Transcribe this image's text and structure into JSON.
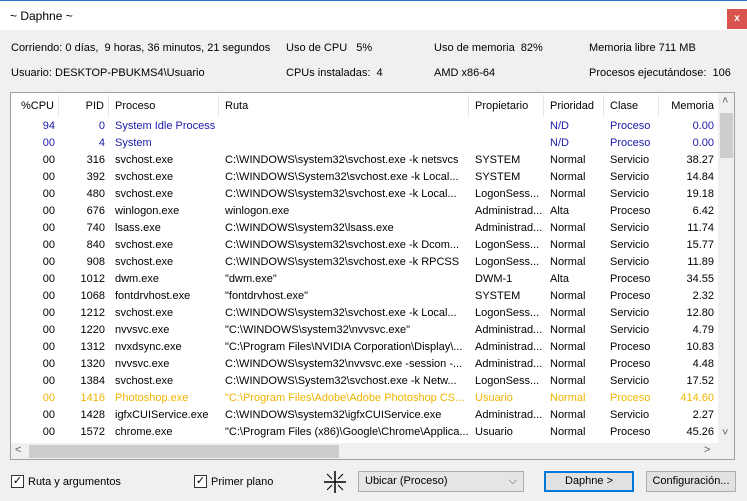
{
  "window": {
    "title": "~ Daphne ~",
    "close_label": "x"
  },
  "info": {
    "uptime": "Corriendo: 0 días,  9 horas, 36 minutos, 21 segundos",
    "cpu_usage": "Uso de CPU   5%",
    "memory_usage": "Uso de memoria  82%",
    "free_memory": "Memoria libre 711 MB",
    "user": "Usuario: DESKTOP-PBUKMS4\\Usuario",
    "cpus": "CPUs instaladas:  4",
    "arch": "AMD x86-64",
    "processes": "Procesos ejecutándose:  106"
  },
  "colors": {
    "system": "#1a1aa6",
    "highlight": "#f0b400",
    "normal": "#000000"
  },
  "table": {
    "columns": [
      "%CPU",
      "PID",
      "Proceso",
      "Ruta",
      "Propietario",
      "Prioridad",
      "Clase",
      "Memoria"
    ],
    "rows": [
      {
        "cpu": "94",
        "pid": "0",
        "name": "System Idle Process",
        "path": "",
        "owner": "",
        "priority": "N/D",
        "class": "Proceso",
        "mem": "0.00",
        "style": "system"
      },
      {
        "cpu": "00",
        "pid": "4",
        "name": "System",
        "path": "",
        "owner": "",
        "priority": "N/D",
        "class": "Proceso",
        "mem": "0.00",
        "style": "system"
      },
      {
        "cpu": "00",
        "pid": "316",
        "name": "svchost.exe",
        "path": "C:\\WINDOWS\\system32\\svchost.exe -k netsvcs",
        "owner": "SYSTEM",
        "priority": "Normal",
        "class": "Servicio",
        "mem": "38.27",
        "style": "normal"
      },
      {
        "cpu": "00",
        "pid": "392",
        "name": "svchost.exe",
        "path": "C:\\WINDOWS\\System32\\svchost.exe -k Local...",
        "owner": "SYSTEM",
        "priority": "Normal",
        "class": "Servicio",
        "mem": "14.84",
        "style": "normal"
      },
      {
        "cpu": "00",
        "pid": "480",
        "name": "svchost.exe",
        "path": "C:\\WINDOWS\\system32\\svchost.exe -k Local...",
        "owner": "LogonSess...",
        "priority": "Normal",
        "class": "Servicio",
        "mem": "19.18",
        "style": "normal"
      },
      {
        "cpu": "00",
        "pid": "676",
        "name": "winlogon.exe",
        "path": "winlogon.exe",
        "owner": "Administrad...",
        "priority": "Alta",
        "class": "Proceso",
        "mem": "6.42",
        "style": "normal"
      },
      {
        "cpu": "00",
        "pid": "740",
        "name": "lsass.exe",
        "path": "C:\\WINDOWS\\system32\\lsass.exe",
        "owner": "Administrad...",
        "priority": "Normal",
        "class": "Servicio",
        "mem": "11.74",
        "style": "normal"
      },
      {
        "cpu": "00",
        "pid": "840",
        "name": "svchost.exe",
        "path": "C:\\WINDOWS\\system32\\svchost.exe -k Dcom...",
        "owner": "LogonSess...",
        "priority": "Normal",
        "class": "Servicio",
        "mem": "15.77",
        "style": "normal"
      },
      {
        "cpu": "00",
        "pid": "908",
        "name": "svchost.exe",
        "path": "C:\\WINDOWS\\system32\\svchost.exe -k RPCSS",
        "owner": "LogonSess...",
        "priority": "Normal",
        "class": "Servicio",
        "mem": "11.89",
        "style": "normal"
      },
      {
        "cpu": "00",
        "pid": "1012",
        "name": "dwm.exe",
        "path": "\"dwm.exe\"",
        "owner": "DWM-1",
        "priority": "Alta",
        "class": "Proceso",
        "mem": "34.55",
        "style": "normal"
      },
      {
        "cpu": "00",
        "pid": "1068",
        "name": "fontdrvhost.exe",
        "path": "\"fontdrvhost.exe\"",
        "owner": "SYSTEM",
        "priority": "Normal",
        "class": "Proceso",
        "mem": "2.32",
        "style": "normal"
      },
      {
        "cpu": "00",
        "pid": "1212",
        "name": "svchost.exe",
        "path": "C:\\WINDOWS\\system32\\svchost.exe -k Local...",
        "owner": "LogonSess...",
        "priority": "Normal",
        "class": "Servicio",
        "mem": "12.80",
        "style": "normal"
      },
      {
        "cpu": "00",
        "pid": "1220",
        "name": "nvvsvc.exe",
        "path": "\"C:\\WINDOWS\\system32\\nvvsvc.exe\"",
        "owner": "Administrad...",
        "priority": "Normal",
        "class": "Servicio",
        "mem": "4.79",
        "style": "normal"
      },
      {
        "cpu": "00",
        "pid": "1312",
        "name": "nvxdsync.exe",
        "path": "\"C:\\Program Files\\NVIDIA Corporation\\Display\\...",
        "owner": "Administrad...",
        "priority": "Normal",
        "class": "Proceso",
        "mem": "10.83",
        "style": "normal"
      },
      {
        "cpu": "00",
        "pid": "1320",
        "name": "nvvsvc.exe",
        "path": "C:\\WINDOWS\\system32\\nvvsvc.exe -session -...",
        "owner": "Administrad...",
        "priority": "Normal",
        "class": "Proceso",
        "mem": "4.48",
        "style": "normal"
      },
      {
        "cpu": "00",
        "pid": "1384",
        "name": "svchost.exe",
        "path": "C:\\WINDOWS\\System32\\svchost.exe -k Netw...",
        "owner": "LogonSess...",
        "priority": "Normal",
        "class": "Servicio",
        "mem": "17.52",
        "style": "normal"
      },
      {
        "cpu": "00",
        "pid": "1416",
        "name": "Photoshop.exe",
        "path": "\"C:\\Program Files\\Adobe\\Adobe Photoshop CS...",
        "owner": "Usuario",
        "priority": "Normal",
        "class": "Proceso",
        "mem": "414.60",
        "style": "highlight"
      },
      {
        "cpu": "00",
        "pid": "1428",
        "name": "igfxCUIService.exe",
        "path": "C:\\WINDOWS\\system32\\igfxCUIService.exe",
        "owner": "Administrad...",
        "priority": "Normal",
        "class": "Servicio",
        "mem": "2.27",
        "style": "normal"
      },
      {
        "cpu": "00",
        "pid": "1572",
        "name": "chrome.exe",
        "path": "\"C:\\Program Files (x86)\\Google\\Chrome\\Applica...",
        "owner": "Usuario",
        "priority": "Normal",
        "class": "Proceso",
        "mem": "45.26",
        "style": "normal"
      }
    ]
  },
  "footer": {
    "path_args_label": "Ruta y argumentos",
    "path_args_checked": true,
    "foreground_label": "Primer plano",
    "foreground_checked": true,
    "crosshair_icon": "crosshair-icon",
    "locate_select": "Ubicar (Proceso)",
    "daphne_button": "Daphne >",
    "config_button": "Configuración..."
  }
}
